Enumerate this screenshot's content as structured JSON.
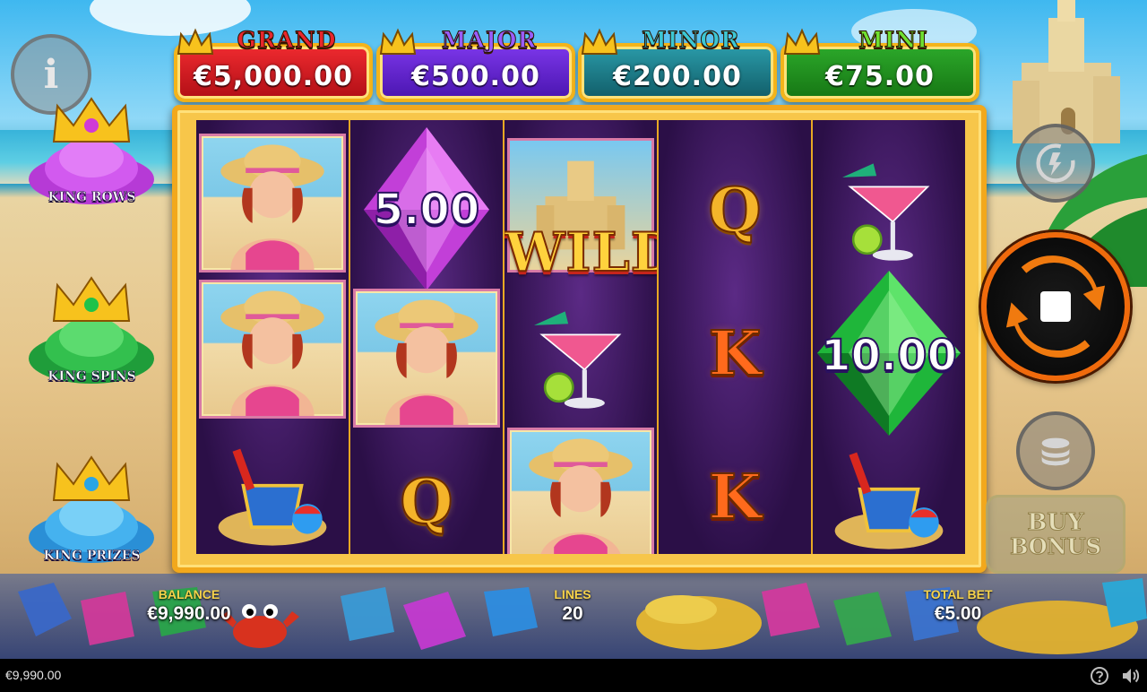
{
  "jackpots": [
    {
      "title": "GRAND",
      "value": "€5,000.00",
      "title_color": "#e8262c",
      "plate_color": "#c8141b"
    },
    {
      "title": "MAJOR",
      "value": "€500.00",
      "title_color": "#8a4cff",
      "plate_color": "#5a1fc8"
    },
    {
      "title": "MINOR",
      "value": "€200.00",
      "title_color": "#2fb9c8",
      "plate_color": "#17717e"
    },
    {
      "title": "MINI",
      "value": "€75.00",
      "title_color": "#62d62a",
      "plate_color": "#1f8d1c"
    }
  ],
  "features": {
    "rows": "KING ROWS",
    "spins": "KING SPINS",
    "prizes": "KING PRIZES"
  },
  "info_label": "i",
  "reels": {
    "gem1_value": "5.00",
    "gem2_value": "10.00",
    "wild": "WILD",
    "q": "Q",
    "k": "K"
  },
  "buy_bonus": {
    "line1": "BUY",
    "line2": "BONUS"
  },
  "stats": {
    "balance_label": "BALANCE",
    "balance_value": "€9,990.00",
    "lines_label": "LINES",
    "lines_value": "20",
    "bet_label": "TOTAL BET",
    "bet_value": "€5.00"
  },
  "footer": {
    "balance": "€9,990.00"
  },
  "icons": [
    "info-icon",
    "autoplay-icon",
    "stop-icon",
    "coin-stack-icon",
    "help-icon",
    "sound-icon"
  ]
}
